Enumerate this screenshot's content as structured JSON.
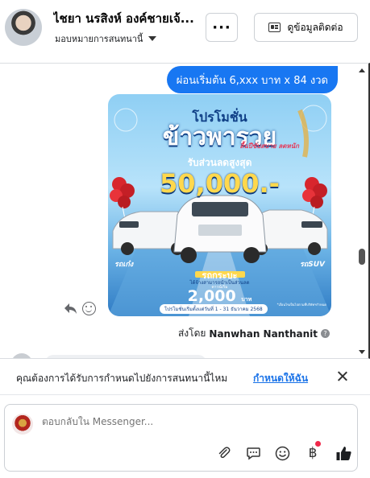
{
  "header": {
    "name": "ไชยา นรสิงห์ องค์ชายเจ้...",
    "assign_label": "มอบหมายการสนทนานี้",
    "more_label": "···",
    "contact_label": "ดูข้อมูลติดต่อ"
  },
  "thread": {
    "bubble_text": "ผ่อนเริ่มต้น 6,xxx บาท x 84 งวด",
    "sent_by_prefix": "ส่งโดย",
    "sent_by_name": "Nanwhan Nanthanit",
    "promo": {
      "title_line1": "โปรโมชั่น",
      "title_line2": "ข้าวพารวย",
      "tag": "ลื้นปีขับสบาย ลดหนัก",
      "subtitle": "รับส่วนลดสูงสุด",
      "amount": "50,000.-",
      "left_label": "รถเก๋ง",
      "right_label": "รถSUV",
      "truck_label": "รถกระบะ",
      "truck_note": "ได้จ้างสามารถนำเป็นส่วนลด",
      "down_label": "ดาวน์เริ่ม",
      "price": "2,000",
      "price_unit": "บาท",
      "date_text": "โปรโมชั่นเริ่มตั้งแต่วันที่ 1 - 31 ธันวาคม 2568",
      "footer_note": "*เงื่อนไขเป็นไปตามที่บริษัทฯกำหนด"
    }
  },
  "assign_prompt": {
    "question": "คุณต้องการได้รับการกำหนดไปยังการสนทนานี้ไหม",
    "link": "กำหนดให้ฉัน"
  },
  "composer": {
    "placeholder": "ตอบกลับใน Messenger..."
  },
  "icons": {
    "attach": "paperclip-icon",
    "quick_reply": "chat-bubble-icon",
    "emoji": "smiley-icon",
    "payment": "baht-icon",
    "like": "thumbs-up-icon"
  },
  "colors": {
    "accent": "#1877f2",
    "link": "#1a73e8",
    "notify": "#f0284a"
  }
}
